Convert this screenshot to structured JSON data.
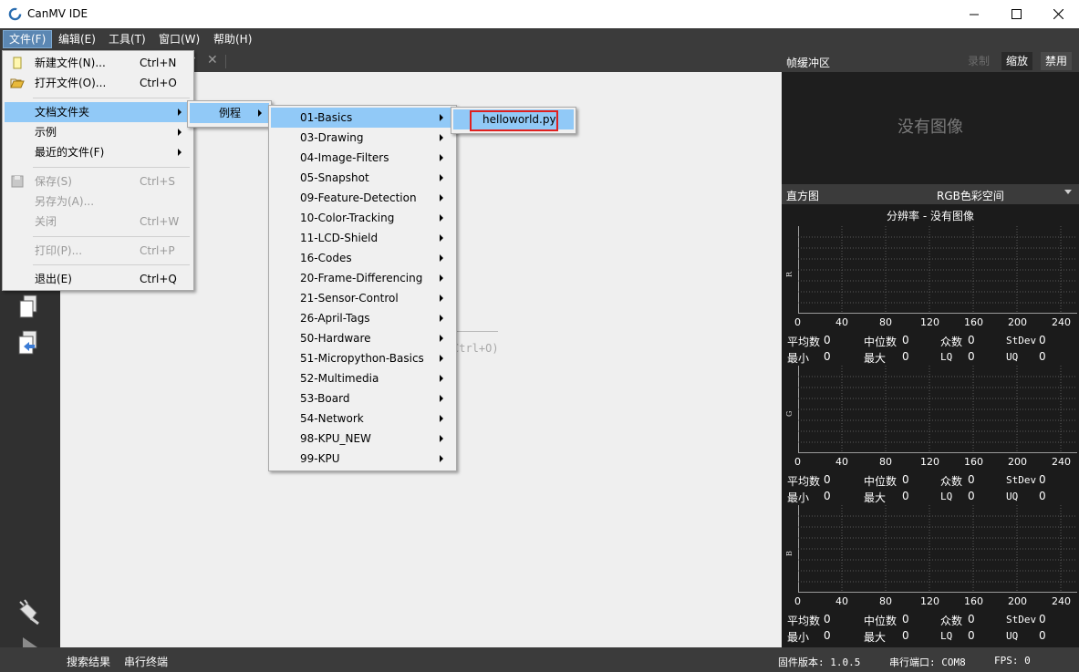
{
  "window": {
    "title": "CanMV IDE",
    "accent": "#91c9f7"
  },
  "menubar": {
    "items": [
      "文件(F)",
      "编辑(E)",
      "工具(T)",
      "窗口(W)",
      "帮助(H)"
    ]
  },
  "file_menu": {
    "items": [
      {
        "label": "新建文件(N)...",
        "shortcut": "Ctrl+N"
      },
      {
        "label": "打开文件(O)...",
        "shortcut": "Ctrl+O"
      },
      {
        "label": "文档文件夹"
      },
      {
        "label": "示例"
      },
      {
        "label": "最近的文件(F)"
      },
      {
        "label": "保存(S)",
        "shortcut": "Ctrl+S"
      },
      {
        "label": "另存为(A)..."
      },
      {
        "label": "关闭",
        "shortcut": "Ctrl+W"
      },
      {
        "label": "打印(P)...",
        "shortcut": "Ctrl+P"
      },
      {
        "label": "退出(E)",
        "shortcut": "Ctrl+Q"
      }
    ]
  },
  "submenu1": {
    "label": "例程"
  },
  "examples_menu": {
    "items": [
      "01-Basics",
      "03-Drawing",
      "04-Image-Filters",
      "05-Snapshot",
      "09-Feature-Detection",
      "10-Color-Tracking",
      "11-LCD-Shield",
      "16-Codes",
      "20-Frame-Differencing",
      "21-Sensor-Control",
      "26-April-Tags",
      "50-Hardware",
      "51-Micropython-Basics",
      "52-Multimedia",
      "53-Board",
      "54-Network",
      "98-KPU_NEW",
      "99-KPU"
    ]
  },
  "basics_menu": {
    "item": "helloworld.py"
  },
  "editor": {
    "hint": "Ctrl+O)"
  },
  "framebuffer": {
    "title": "帧缓冲区",
    "record": "录制",
    "zoom": "缩放",
    "disable": "禁用",
    "no_image": "没有图像"
  },
  "histogram": {
    "title": "直方图",
    "colorspace": "RGB色彩空间",
    "resolution": "分辨率 - 没有图像",
    "ticks": [
      "0",
      "40",
      "80",
      "120",
      "160",
      "200",
      "240"
    ],
    "channels": [
      {
        "label": "R",
        "mean": "平均数",
        "mean_v": "0",
        "median": "中位数",
        "median_v": "0",
        "mode": "众数",
        "mode_v": "0",
        "stdev": "StDev",
        "stdev_v": "0",
        "min": "最小",
        "min_v": "0",
        "max": "最大",
        "max_v": "0",
        "lq": "LQ",
        "lq_v": "0",
        "uq": "UQ",
        "uq_v": "0"
      },
      {
        "label": "G",
        "mean": "平均数",
        "mean_v": "0",
        "median": "中位数",
        "median_v": "0",
        "mode": "众数",
        "mode_v": "0",
        "stdev": "StDev",
        "stdev_v": "0",
        "min": "最小",
        "min_v": "0",
        "max": "最大",
        "max_v": "0",
        "lq": "LQ",
        "lq_v": "0",
        "uq": "UQ",
        "uq_v": "0"
      },
      {
        "label": "B",
        "mean": "平均数",
        "mean_v": "0",
        "median": "中位数",
        "median_v": "0",
        "mode": "众数",
        "mode_v": "0",
        "stdev": "StDev",
        "stdev_v": "0",
        "min": "最小",
        "min_v": "0",
        "max": "最大",
        "max_v": "0",
        "lq": "LQ",
        "lq_v": "0",
        "uq": "UQ",
        "uq_v": "0"
      }
    ]
  },
  "statusbar": {
    "search_results": "搜索结果",
    "serial_terminal": "串行终端",
    "firmware": "固件版本: 1.0.5",
    "serial_port": "串行端口: COM8",
    "fps": "FPS: 0"
  }
}
